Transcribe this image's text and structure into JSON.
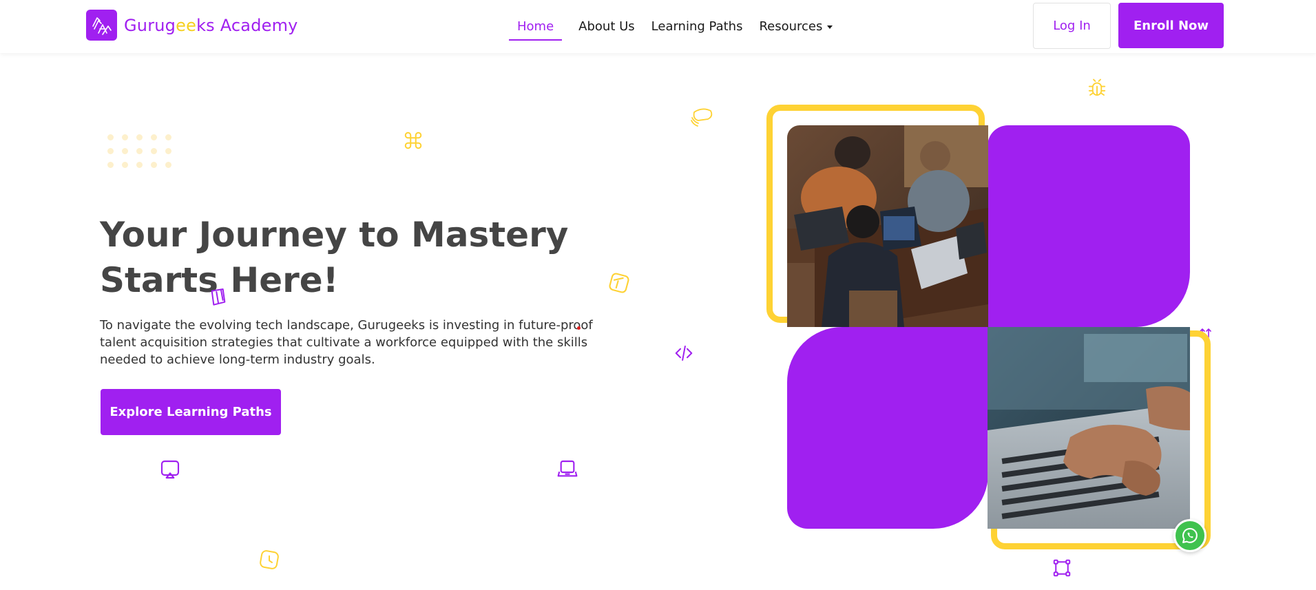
{
  "header": {
    "logo": {
      "name_part1": "Gurug",
      "name_highlight": "ee",
      "name_part2": "ks Academy",
      "icon": "logo-hands-icon"
    },
    "nav": [
      {
        "label": "Home",
        "active": true
      },
      {
        "label": "About Us",
        "active": false
      },
      {
        "label": "Learning Paths",
        "active": false
      },
      {
        "label": "Resources",
        "active": false,
        "has_dropdown": true
      }
    ],
    "login_label": "Log In",
    "enroll_label": "Enroll Now"
  },
  "hero": {
    "title_line1": "Your Journey to Mastery",
    "title_line2": "Starts Here!",
    "description": "To navigate the evolving tech landscape, Gurugeeks is investing in future-proof talent acquisition strategies that cultivate a workforce equipped with the skills needed to achieve long-term industry goals.",
    "cta_label": "Explore Learning Paths"
  },
  "decorative_icons": [
    "command-icon",
    "cloud-wifi-icon",
    "bug-icon",
    "notebook-icon",
    "cube-icon",
    "code-icon",
    "cast-icon",
    "laptop-icon",
    "clock-icon",
    "nodes-icon",
    "arrows-icon"
  ],
  "images": {
    "top_left": "team-working-on-laptops-photo",
    "bottom_right": "hands-typing-on-laptop-photo"
  },
  "floating": {
    "icon": "whatsapp-icon"
  },
  "colors": {
    "brand_purple": "#a020f0",
    "accent_yellow": "#fed234",
    "heading_gray": "#454545",
    "whatsapp_green": "#3fc24e"
  }
}
